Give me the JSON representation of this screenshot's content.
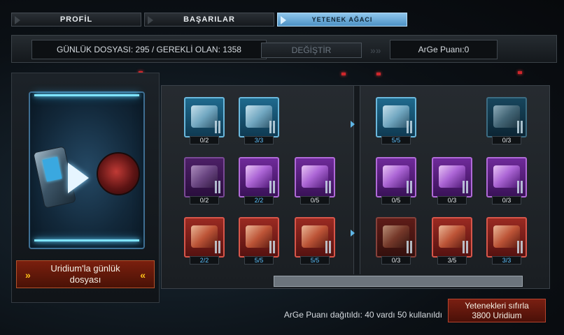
{
  "tabs": [
    {
      "label": "PROFİL",
      "active": false
    },
    {
      "label": "BAŞARILAR",
      "active": false
    },
    {
      "label": "YETENEK AĞACI",
      "active": true
    }
  ],
  "info": {
    "daily_file": "GÜNLÜK DOSYASI: 295 / GEREKLİ OLAN: 1358",
    "change_label": "DEĞİŞTİR",
    "arge_points": "ArGe Puanı:0"
  },
  "left_panel": {
    "uridium_button_line1": "Uridium'la günlük",
    "uridium_button_line2": "dosyası"
  },
  "skills": [
    {
      "id": "s1",
      "value": "0/2",
      "tier": "blue",
      "icon": "ship-icon"
    },
    {
      "id": "s2",
      "value": "3/3",
      "tier": "blue",
      "icon": "cargo-icon"
    },
    {
      "id": "s3",
      "value": "5/5",
      "tier": "blue",
      "icon": "drone-icon"
    },
    {
      "id": "s4",
      "value": "0/3",
      "tier": "blue",
      "icon": "ship-icon"
    },
    {
      "id": "s5",
      "value": "0/2",
      "tier": "purple",
      "icon": "crate-icon"
    },
    {
      "id": "s6",
      "value": "2/2",
      "tier": "purple",
      "icon": "fist-icon"
    },
    {
      "id": "s7",
      "value": "0/5",
      "tier": "purple",
      "icon": "missile-icon"
    },
    {
      "id": "s8",
      "value": "0/5",
      "tier": "purple",
      "icon": "hand-icon"
    },
    {
      "id": "s9",
      "value": "0/3",
      "tier": "purple",
      "icon": "missile-icon"
    },
    {
      "id": "s10",
      "value": "0/3",
      "tier": "purple",
      "icon": "fist-icon"
    },
    {
      "id": "s11",
      "value": "2/2",
      "tier": "red",
      "icon": "head-icon"
    },
    {
      "id": "s12",
      "value": "5/5",
      "tier": "red",
      "icon": "gun-icon"
    },
    {
      "id": "s13",
      "value": "5/5",
      "tier": "red",
      "icon": "blade-icon"
    },
    {
      "id": "s14",
      "value": "0/3",
      "tier": "red",
      "icon": "skull-icon"
    },
    {
      "id": "s15",
      "value": "3/5",
      "tier": "red",
      "icon": "ship-icon"
    },
    {
      "id": "s16",
      "value": "3/3",
      "tier": "red",
      "icon": "head-icon"
    }
  ],
  "bottom": {
    "status": "ArGe Puanı dağıtıldı: 40 vardı 50 kullanıldı",
    "reset_line1": "Yetenekleri sıfırla",
    "reset_line2": "3800 Uridium"
  }
}
